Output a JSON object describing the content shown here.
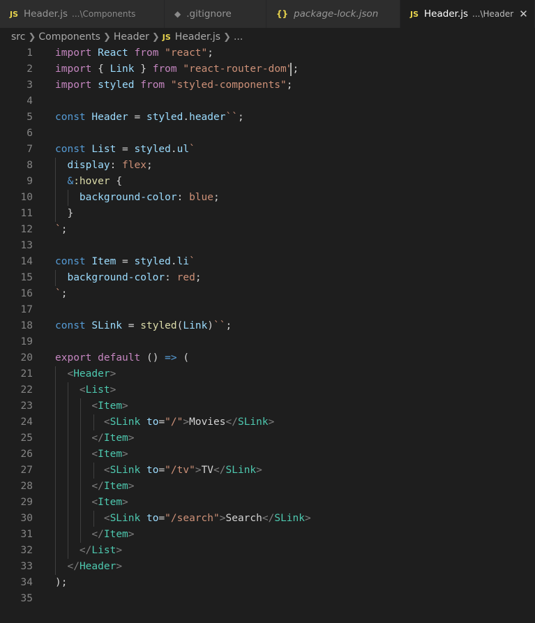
{
  "tabs": [
    {
      "label": "Header.js",
      "desc": "...\\Components",
      "icon": "JS",
      "icon_name": "js-file-icon",
      "active": false
    },
    {
      "label": ".gitignore",
      "desc": "",
      "icon": "◆",
      "icon_name": "gitignore-file-icon",
      "active": false
    },
    {
      "label": "package-lock.json",
      "desc": "",
      "icon": "{}",
      "icon_name": "json-file-icon",
      "active": false
    },
    {
      "label": "Header.js",
      "desc": "...\\Header",
      "icon": "JS",
      "icon_name": "js-file-icon",
      "active": true
    }
  ],
  "close_label": "✕",
  "breadcrumb": [
    "src",
    "Components",
    "Header",
    "Header.js",
    "..."
  ],
  "breadcrumb_file_icon": "JS",
  "code": [
    [
      [
        "import",
        "kw"
      ],
      [
        " React ",
        "id"
      ],
      [
        "from",
        "kw"
      ],
      [
        " ",
        "tx"
      ],
      [
        "\"react\"",
        "str"
      ],
      [
        ";",
        "tx"
      ]
    ],
    [
      [
        "import",
        "kw"
      ],
      [
        " { ",
        "tx"
      ],
      [
        "Link",
        "id"
      ],
      [
        " } ",
        "tx"
      ],
      [
        "from",
        "kw"
      ],
      [
        " ",
        "tx"
      ],
      [
        "\"react-router-dom\"",
        "str"
      ],
      [
        ";",
        "tx"
      ]
    ],
    [
      [
        "import",
        "kw"
      ],
      [
        " styled ",
        "id"
      ],
      [
        "from",
        "kw"
      ],
      [
        " ",
        "tx"
      ],
      [
        "\"styled-components\"",
        "str"
      ],
      [
        ";",
        "tx"
      ]
    ],
    [],
    [
      [
        "const",
        "st"
      ],
      [
        " Header",
        "id"
      ],
      [
        " = ",
        "tx"
      ],
      [
        "styled",
        "id"
      ],
      [
        ".",
        "tx"
      ],
      [
        "header",
        "id"
      ],
      [
        "``",
        "str"
      ],
      [
        ";",
        "tx"
      ]
    ],
    [],
    [
      [
        "const",
        "st"
      ],
      [
        " List",
        "id"
      ],
      [
        " = ",
        "tx"
      ],
      [
        "styled",
        "id"
      ],
      [
        ".",
        "tx"
      ],
      [
        "ul",
        "id"
      ],
      [
        "`",
        "str"
      ]
    ],
    [
      [
        "  ",
        "tx"
      ],
      [
        "display",
        "id"
      ],
      [
        ": ",
        "tx"
      ],
      [
        "flex",
        "str"
      ],
      [
        ";",
        "tx"
      ]
    ],
    [
      [
        "  ",
        "tx"
      ],
      [
        "&",
        "st"
      ],
      [
        ":hover",
        "fn"
      ],
      [
        " {",
        "tx"
      ]
    ],
    [
      [
        "    ",
        "tx"
      ],
      [
        "background-color",
        "id"
      ],
      [
        ": ",
        "tx"
      ],
      [
        "blue",
        "str"
      ],
      [
        ";",
        "tx"
      ]
    ],
    [
      [
        "  }",
        "tx"
      ]
    ],
    [
      [
        "`",
        "str"
      ],
      [
        ";",
        "tx"
      ]
    ],
    [],
    [
      [
        "const",
        "st"
      ],
      [
        " Item",
        "id"
      ],
      [
        " = ",
        "tx"
      ],
      [
        "styled",
        "id"
      ],
      [
        ".",
        "tx"
      ],
      [
        "li",
        "id"
      ],
      [
        "`",
        "str"
      ]
    ],
    [
      [
        "  ",
        "tx"
      ],
      [
        "background-color",
        "id"
      ],
      [
        ": ",
        "tx"
      ],
      [
        "red",
        "str"
      ],
      [
        ";",
        "tx"
      ]
    ],
    [
      [
        "`",
        "str"
      ],
      [
        ";",
        "tx"
      ]
    ],
    [],
    [
      [
        "const",
        "st"
      ],
      [
        " SLink",
        "id"
      ],
      [
        " = ",
        "tx"
      ],
      [
        "styled",
        "fn"
      ],
      [
        "(",
        "tx"
      ],
      [
        "Link",
        "id"
      ],
      [
        ")",
        "tx"
      ],
      [
        "``",
        "str"
      ],
      [
        ";",
        "tx"
      ]
    ],
    [],
    [
      [
        "export",
        "kw"
      ],
      [
        " ",
        "tx"
      ],
      [
        "default",
        "kw"
      ],
      [
        " () ",
        "tx"
      ],
      [
        "=>",
        "st"
      ],
      [
        " (",
        "tx"
      ]
    ],
    [
      [
        "  ",
        "tx"
      ],
      [
        "<",
        "pu"
      ],
      [
        "Header",
        "tag"
      ],
      [
        ">",
        "pu"
      ]
    ],
    [
      [
        "    ",
        "tx"
      ],
      [
        "<",
        "pu"
      ],
      [
        "List",
        "tag"
      ],
      [
        ">",
        "pu"
      ]
    ],
    [
      [
        "      ",
        "tx"
      ],
      [
        "<",
        "pu"
      ],
      [
        "Item",
        "tag"
      ],
      [
        ">",
        "pu"
      ]
    ],
    [
      [
        "        ",
        "tx"
      ],
      [
        "<",
        "pu"
      ],
      [
        "SLink",
        "tag"
      ],
      [
        " ",
        "tx"
      ],
      [
        "to",
        "id"
      ],
      [
        "=",
        "tx"
      ],
      [
        "\"/\"",
        "str"
      ],
      [
        ">",
        "pu"
      ],
      [
        "Movies",
        "tx"
      ],
      [
        "</",
        "pu"
      ],
      [
        "SLink",
        "tag"
      ],
      [
        ">",
        "pu"
      ]
    ],
    [
      [
        "      ",
        "tx"
      ],
      [
        "</",
        "pu"
      ],
      [
        "Item",
        "tag"
      ],
      [
        ">",
        "pu"
      ]
    ],
    [
      [
        "      ",
        "tx"
      ],
      [
        "<",
        "pu"
      ],
      [
        "Item",
        "tag"
      ],
      [
        ">",
        "pu"
      ]
    ],
    [
      [
        "        ",
        "tx"
      ],
      [
        "<",
        "pu"
      ],
      [
        "SLink",
        "tag"
      ],
      [
        " ",
        "tx"
      ],
      [
        "to",
        "id"
      ],
      [
        "=",
        "tx"
      ],
      [
        "\"/tv\"",
        "str"
      ],
      [
        ">",
        "pu"
      ],
      [
        "TV",
        "tx"
      ],
      [
        "</",
        "pu"
      ],
      [
        "SLink",
        "tag"
      ],
      [
        ">",
        "pu"
      ]
    ],
    [
      [
        "      ",
        "tx"
      ],
      [
        "</",
        "pu"
      ],
      [
        "Item",
        "tag"
      ],
      [
        ">",
        "pu"
      ]
    ],
    [
      [
        "      ",
        "tx"
      ],
      [
        "<",
        "pu"
      ],
      [
        "Item",
        "tag"
      ],
      [
        ">",
        "pu"
      ]
    ],
    [
      [
        "        ",
        "tx"
      ],
      [
        "<",
        "pu"
      ],
      [
        "SLink",
        "tag"
      ],
      [
        " ",
        "tx"
      ],
      [
        "to",
        "id"
      ],
      [
        "=",
        "tx"
      ],
      [
        "\"/search\"",
        "str"
      ],
      [
        ">",
        "pu"
      ],
      [
        "Search",
        "tx"
      ],
      [
        "</",
        "pu"
      ],
      [
        "SLink",
        "tag"
      ],
      [
        ">",
        "pu"
      ]
    ],
    [
      [
        "      ",
        "tx"
      ],
      [
        "</",
        "pu"
      ],
      [
        "Item",
        "tag"
      ],
      [
        ">",
        "pu"
      ]
    ],
    [
      [
        "    ",
        "tx"
      ],
      [
        "</",
        "pu"
      ],
      [
        "List",
        "tag"
      ],
      [
        ">",
        "pu"
      ]
    ],
    [
      [
        "  ",
        "tx"
      ],
      [
        "</",
        "pu"
      ],
      [
        "Header",
        "tag"
      ],
      [
        ">",
        "pu"
      ]
    ],
    [
      [
        ");",
        "tx"
      ]
    ],
    []
  ],
  "theme": {
    "background": "#1e1e1e",
    "keyword": "#c586c0",
    "storage": "#569cd6",
    "tag": "#4ec9b0",
    "string": "#ce9178",
    "variable": "#9cdcfe",
    "function": "#dcdcaa",
    "js_icon": "#e8d44d"
  }
}
